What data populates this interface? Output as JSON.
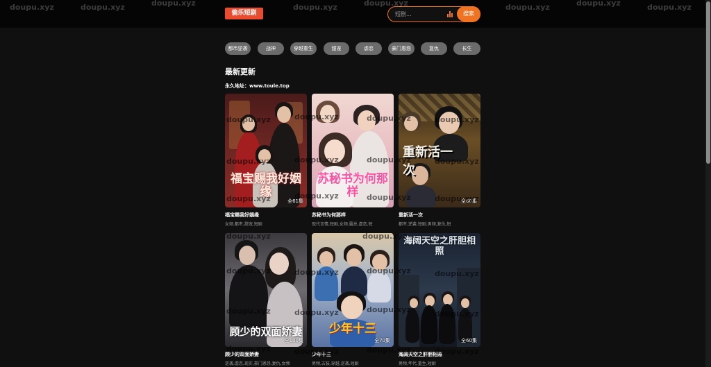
{
  "header": {
    "logo_text": "偷乐短剧",
    "search_placeholder": "短剧...",
    "search_button": "搜索",
    "chart_icon": "bar-chart-icon"
  },
  "categories": [
    "都市逆袭",
    "战神",
    "穿越重生",
    "甜宠",
    "虐恋",
    "豪门恩怨",
    "复仇",
    "长生"
  ],
  "section": {
    "title": "最新更新",
    "notice": "永久地址：www.toule.top"
  },
  "watermark": "doupu.xyz",
  "cards": [
    {
      "title": "福宝赐我好姻缘",
      "tags": "女频,都市,甜宠,短剧",
      "episodes": "全61集",
      "art": "福宝赐我好姻缘"
    },
    {
      "title": "苏秘书为何那样",
      "tags": "现代言情,短剧,女频,霸总,虐恋,短",
      "episodes": "",
      "art": "苏秘书为何那样"
    },
    {
      "title": "重新活一次",
      "tags": "都市,逆袭,短剧,男频,复仇,短",
      "episodes": "全60集",
      "art": "重新活一次"
    },
    {
      "title": "顾少的双面娇妻",
      "tags": "逆袭,虐恋,现实,豪门恩怨,复仇,女频",
      "episodes": "全100集",
      "art": "顾少的双面娇妻"
    },
    {
      "title": "少年十三",
      "tags": "男频,古装,穿越,逆袭,短剧",
      "episodes": "全70集",
      "art": "少年十三"
    },
    {
      "title": "海阔天空之肝胆相照",
      "tags": "男频,年代,重生,短剧",
      "episodes": "全60集",
      "art": "海阔天空之肝胆相照"
    }
  ],
  "colors": {
    "accent": "#f07322",
    "logo_bg": "#e94b2f",
    "chip_bg": "#6b6b6b",
    "page_bg": "#101010"
  }
}
